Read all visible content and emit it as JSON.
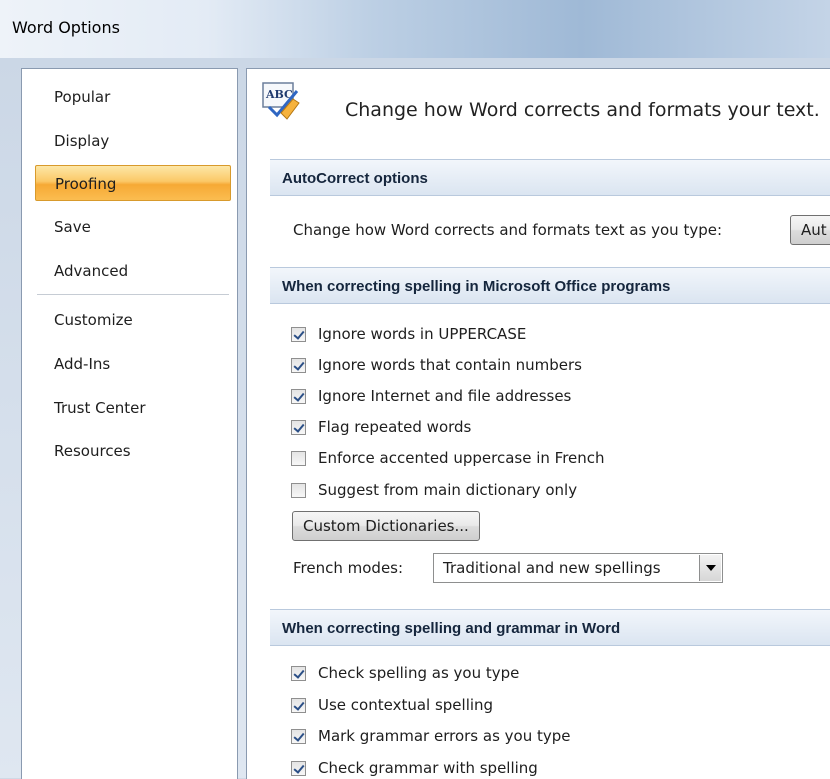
{
  "window": {
    "title": "Word Options"
  },
  "sidebar": {
    "items": [
      {
        "label": "Popular",
        "active": false
      },
      {
        "label": "Display",
        "active": false
      },
      {
        "label": "Proofing",
        "active": true
      },
      {
        "label": "Save",
        "active": false
      },
      {
        "label": "Advanced",
        "active": false
      },
      {
        "label": "Customize",
        "active": false
      },
      {
        "label": "Add-Ins",
        "active": false
      },
      {
        "label": "Trust Center",
        "active": false
      },
      {
        "label": "Resources",
        "active": false
      }
    ]
  },
  "main": {
    "header": {
      "icon": "abc-proofing-icon",
      "text": "Change how Word corrects and formats your text."
    },
    "autocorrect": {
      "section_title": "AutoCorrect options",
      "description": "Change how Word corrects and formats text as you type:",
      "button_label": "Aut"
    },
    "office_spelling": {
      "section_title": "When correcting spelling in Microsoft Office programs",
      "options": [
        {
          "label": "Ignore words in UPPERCASE",
          "checked": true
        },
        {
          "label": "Ignore words that contain numbers",
          "checked": true
        },
        {
          "label": "Ignore Internet and file addresses",
          "checked": true
        },
        {
          "label": "Flag repeated words",
          "checked": true
        },
        {
          "label": "Enforce accented uppercase in French",
          "checked": false
        },
        {
          "label": "Suggest from main dictionary only",
          "checked": false
        }
      ],
      "custom_dictionaries_label": "Custom Dictionaries...",
      "french_modes_label": "French modes:",
      "french_modes_value": "Traditional and new spellings"
    },
    "word_spelling": {
      "section_title": "When correcting spelling and grammar in Word",
      "options": [
        {
          "label": "Check spelling as you type",
          "checked": true
        },
        {
          "label": "Use contextual spelling",
          "checked": true
        },
        {
          "label": "Mark grammar errors as you type",
          "checked": true
        },
        {
          "label": "Check grammar with spelling",
          "checked": true
        }
      ]
    }
  },
  "colors": {
    "active_nav": "#f9b84a",
    "section_header_text": "#15263d",
    "check_mark": "#2b4f86"
  }
}
